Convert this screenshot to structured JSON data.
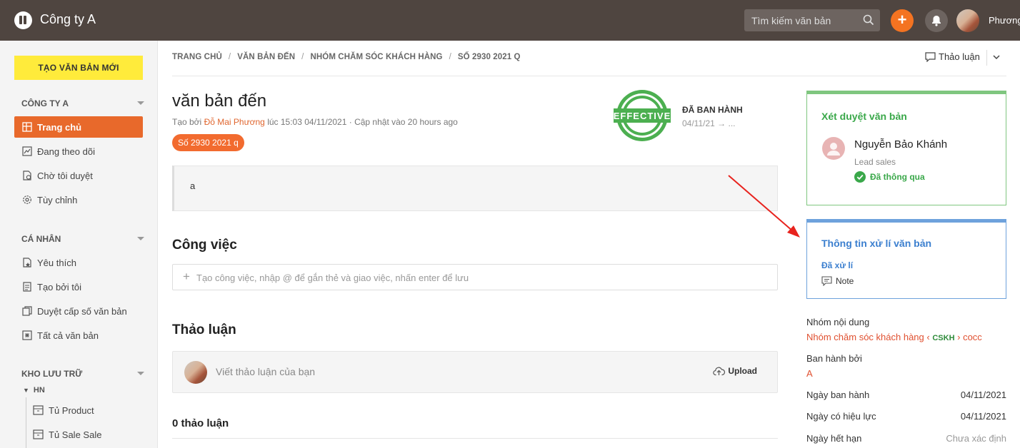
{
  "header": {
    "brand": "Công ty A",
    "search_placeholder": "Tìm kiếm văn bản",
    "user_name": "Phương"
  },
  "sidebar": {
    "new_doc_button": "TẠO VĂN BẢN MỚI",
    "sections": [
      {
        "title": "CÔNG TY A",
        "items": [
          {
            "label": "Trang chủ",
            "icon": "home-grid-icon",
            "active": true
          },
          {
            "label": "Đang theo dõi",
            "icon": "tracking-icon"
          },
          {
            "label": "Chờ tôi duyệt",
            "icon": "pending-approval-icon"
          },
          {
            "label": "Tùy chỉnh",
            "icon": "settings-icon"
          }
        ]
      },
      {
        "title": "CÁ NHÂN",
        "items": [
          {
            "label": "Yêu thích",
            "icon": "favorite-doc-icon"
          },
          {
            "label": "Tạo bởi tôi",
            "icon": "created-by-me-icon"
          },
          {
            "label": "Duyệt cấp số văn bản",
            "icon": "number-approval-icon"
          },
          {
            "label": "Tất cả văn bản",
            "icon": "all-docs-icon"
          }
        ]
      },
      {
        "title": "KHO LƯU TRỮ",
        "tree": {
          "group": "HN",
          "items": [
            {
              "label": "Tủ Product"
            },
            {
              "label": "Tủ Sale Sale"
            }
          ]
        }
      }
    ]
  },
  "breadcrumb": [
    "TRANG CHỦ",
    "VĂN BẢN ĐẾN",
    "NHÓM CHĂM SÓC KHÁCH HÀNG",
    "SỐ 2930 2021 Q"
  ],
  "discussion_button": "Thảo luận",
  "document": {
    "title": "văn bản đến",
    "meta_prefix": "Tạo bởi",
    "author": "Đỗ Mai Phương",
    "meta_suffix": "lúc 15:03 04/11/2021 · Cập nhật vào 20 hours ago",
    "tag": "Số 2930 2021 q",
    "stamp_text": "EFFECTIVE",
    "status": "ĐÃ BAN HÀNH",
    "status_date": "04/11/21 → ...",
    "content": "a"
  },
  "tasks": {
    "heading": "Công việc",
    "placeholder": "Tạo công việc, nhập @ để gắn thẻ và giao việc, nhấn enter để lưu"
  },
  "discussion": {
    "heading": "Thảo luận",
    "placeholder": "Viết thảo luận của bạn",
    "upload_label": "Upload",
    "count_label": "0 thảo luận"
  },
  "approval_card": {
    "title": "Xét duyệt văn bản",
    "approver_name": "Nguyễn Bảo Khánh",
    "approver_role": "Lead sales",
    "status": "Đã thông qua"
  },
  "processing_card": {
    "title": "Thông tin xử lí văn bản",
    "status": "Đã xử lí",
    "note": "Note"
  },
  "properties": {
    "content_group_label": "Nhóm nội dung",
    "content_group_value": "Nhóm chăm sóc khách hàng",
    "content_group_tag": "CSKH",
    "content_group_extra": "cocc",
    "issued_by_label": "Ban hành bởi",
    "issued_by_value": "A",
    "issue_date_label": "Ngày ban hành",
    "issue_date_value": "04/11/2021",
    "effective_date_label": "Ngày có hiệu lực",
    "effective_date_value": "04/11/2021",
    "expiry_date_label": "Ngày hết hạn",
    "expiry_date_value": "Chưa xác định"
  },
  "colors": {
    "topbar": "#4f4540",
    "accent_orange": "#f47321",
    "active_nav": "#e8692b",
    "new_doc_yellow": "#ffeb3b",
    "approve_green": "#3aa84a",
    "info_blue": "#3b7fcf",
    "annotation_arrow": "#e8231e"
  }
}
